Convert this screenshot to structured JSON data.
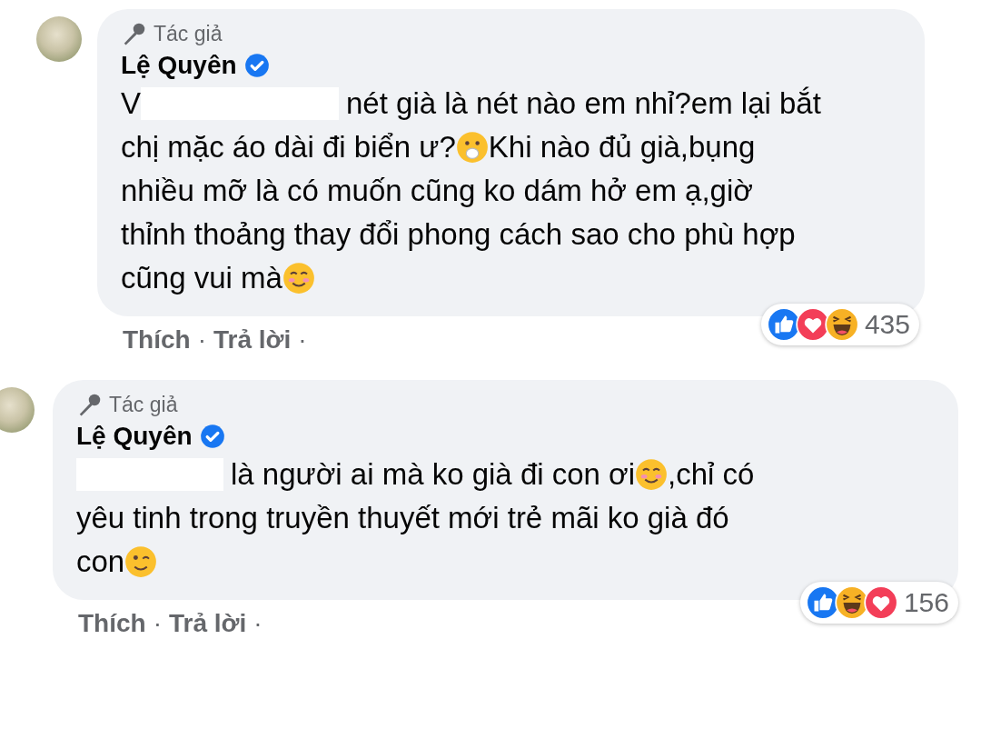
{
  "comments": [
    {
      "badge": "Tác giả",
      "author": "Lệ Quyên",
      "verified": true,
      "lines": [
        [
          {
            "kind": "text",
            "text": "V"
          },
          {
            "kind": "redaction"
          },
          {
            "kind": "text",
            "text": "nét già là nét nào em nhỉ?em lại bắt"
          }
        ],
        [
          {
            "kind": "text",
            "text": "chị mặc áo dài đi biển ư?"
          },
          {
            "kind": "gasp"
          },
          {
            "kind": "text",
            "text": "Khi nào đủ già,bụng"
          }
        ],
        [
          {
            "kind": "text",
            "text": "nhiều mỡ là có muốn cũng ko dám hở em ạ,giờ"
          }
        ],
        [
          {
            "kind": "text",
            "text": "thỉnh thoảng thay đổi phong cách sao cho phù hợp"
          }
        ],
        [
          {
            "kind": "text",
            "text": "cũng vui mà"
          },
          {
            "kind": "smile"
          }
        ]
      ],
      "reactions": [
        {
          "kind": "like"
        },
        {
          "kind": "love"
        },
        {
          "kind": "haha"
        }
      ],
      "reaction_count": "435",
      "actions": [
        "Thích",
        "Trả lời"
      ],
      "separator": "·"
    },
    {
      "badge": "Tác giả",
      "author": "Lệ Quyên",
      "verified": true,
      "lines": [
        [
          {
            "kind": "redaction"
          },
          {
            "kind": "text",
            "text": "là người ai mà ko già đi con ơi"
          },
          {
            "kind": "smile"
          },
          {
            "kind": "text",
            "text": ",chỉ có"
          }
        ],
        [
          {
            "kind": "text",
            "text": "yêu tinh trong truyền thuyết mới trẻ mãi ko già đó"
          }
        ],
        [
          {
            "kind": "text",
            "text": "con"
          },
          {
            "kind": "wink"
          }
        ]
      ],
      "reactions": [
        {
          "kind": "like"
        },
        {
          "kind": "haha"
        },
        {
          "kind": "love"
        }
      ],
      "reaction_count": "156",
      "actions": [
        "Thích",
        "Trả lời"
      ],
      "separator": "·"
    }
  ]
}
